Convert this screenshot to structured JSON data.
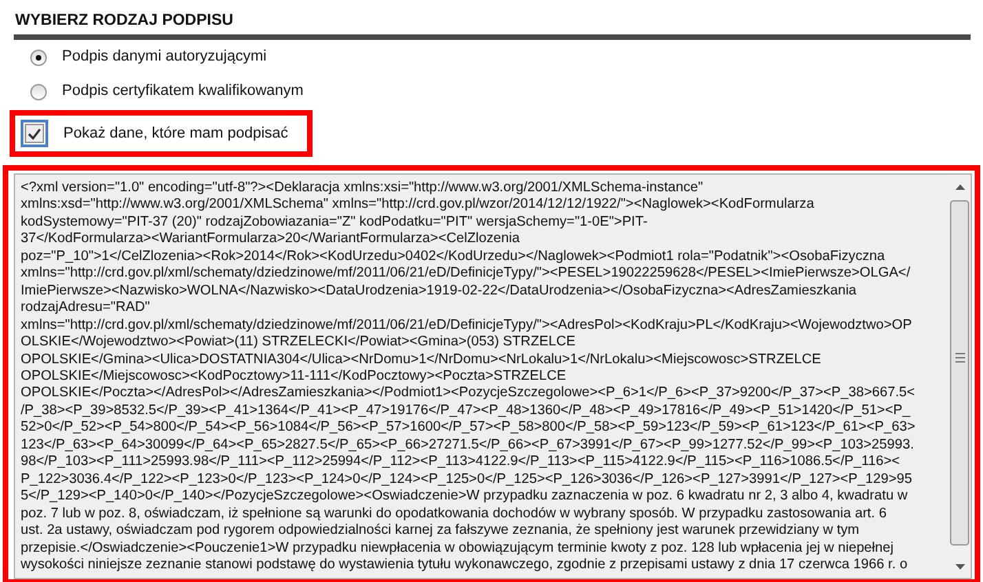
{
  "section_title": "WYBIERZ RODZAJ PODPISU",
  "signature_options": [
    {
      "label": "Podpis danymi autoryzującymi",
      "selected": true
    },
    {
      "label": "Podpis certyfikatem kwalifikowanym",
      "selected": false
    }
  ],
  "show_data": {
    "label": "Pokaż dane, które mam podpisać",
    "checked": true
  },
  "xml_preview": {
    "lines": [
      "<?xml version=\"1.0\" encoding=\"utf-8\"?><Deklaracja xmlns:xsi=\"http://www.w3.org/2001/XMLSchema-instance\"",
      "xmlns:xsd=\"http://www.w3.org/2001/XMLSchema\" xmlns=\"http://crd.gov.pl/wzor/2014/12/12/1922/\"><Naglowek><KodFormularza",
      "kodSystemowy=\"PIT-37 (20)\" rodzajZobowiazania=\"Z\" kodPodatku=\"PIT\" wersjaSchemy=\"1-0E\">PIT-",
      "37</KodFormularza><WariantFormularza>20</WariantFormularza><CelZlozenia",
      "poz=\"P_10\">1</CelZlozenia><Rok>2014</Rok><KodUrzedu>0402</KodUrzedu></Naglowek><Podmiot1 rola=\"Podatnik\"><OsobaFizyczna",
      "xmlns=\"http://crd.gov.pl/xml/schematy/dziedzinowe/mf/2011/06/21/eD/DefinicjeTypy/\"><PESEL>19022259628</PESEL><ImiePierwsze>OLGA</",
      "ImiePierwsze><Nazwisko>WOLNA</Nazwisko><DataUrodzenia>1919-02-22</DataUrodzenia></OsobaFizyczna><AdresZamieszkania",
      "rodzajAdresu=\"RAD\"",
      "xmlns=\"http://crd.gov.pl/xml/schematy/dziedzinowe/mf/2011/06/21/eD/DefinicjeTypy/\"><AdresPol><KodKraju>PL</KodKraju><Wojewodztwo>OP",
      "OLSKIE</Wojewodztwo><Powiat>(11) STRZELECKI</Powiat><Gmina>(053) STRZELCE",
      "OPOLSKIE</Gmina><Ulica>DOSTATNIA304</Ulica><NrDomu>1</NrDomu><NrLokalu>1</NrLokalu><Miejscowosc>STRZELCE",
      "OPOLSKIE</Miejscowosc><KodPocztowy>11-111</KodPocztowy><Poczta>STRZELCE",
      "OPOLSKIE</Poczta></AdresPol></AdresZamieszkania></Podmiot1><PozycjeSzczegolowe><P_6>1</P_6><P_37>9200</P_37><P_38>667.5<",
      "/P_38><P_39>8532.5</P_39><P_41>1364</P_41><P_47>19176</P_47><P_48>1360</P_48><P_49>17816</P_49><P_51>1420</P_51><P_",
      "52>0</P_52><P_54>800</P_54><P_56>1084</P_56><P_57>1600</P_57><P_58>800</P_58><P_59>123</P_59><P_61>123</P_61><P_63>",
      "123</P_63><P_64>30099</P_64><P_65>2827.5</P_65><P_66>27271.5</P_66><P_67>3991</P_67><P_99>1277.52</P_99><P_103>25993.",
      "98</P_103><P_111>25993.98</P_111><P_112>25994</P_112><P_113>4122.9</P_113><P_115>4122.9</P_115><P_116>1086.5</P_116><",
      "P_122>3036.4</P_122><P_123>0</P_123><P_124>0</P_124><P_125>0</P_125><P_126>3036</P_126><P_127>3991</P_127><P_129>95",
      "5</P_129><P_140>0</P_140></PozycjeSzczegolowe><Oswiadczenie>W przypadku zaznaczenia w poz. 6 kwadratu nr 2, 3 albo 4, kwadratu w",
      "poz. 7 lub w poz. 8, oświadczam, iż spełnione są warunki do opodatkowania dochodów w wybrany sposób. W przypadku zastosowania art. 6",
      "ust. 2a ustawy, oświadczam pod rygorem odpowiedzialności karnej za fałszywe zeznania, że spełniony jest warunek przewidziany w tym",
      "przepisie.</Oswiadczenie><Pouczenie1>W przypadku niewpłacenia w obowiązującym terminie kwoty z poz. 128 lub wpłacenia jej w niepełnej",
      "wysokości niniejsze zeznanie stanowi podstawę do wystawienia tytułu wykonawczego, zgodnie z przepisami ustawy z dnia 17 czerwca 1966 r. o"
    ]
  }
}
